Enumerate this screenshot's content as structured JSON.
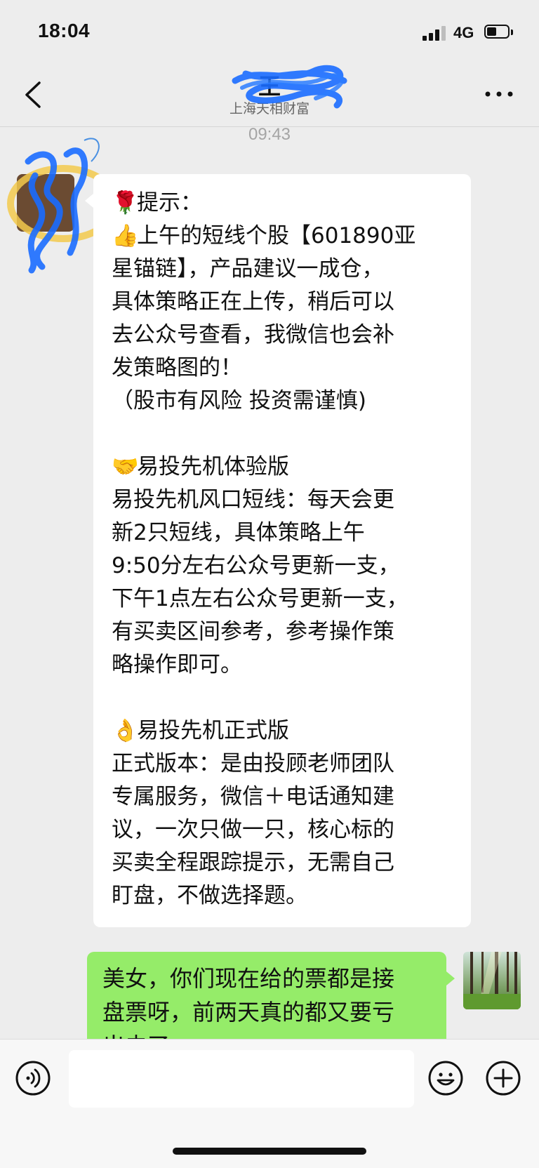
{
  "status": {
    "time": "18:04",
    "network": "4G",
    "battery_level": 0.45
  },
  "nav": {
    "title": "王",
    "subtitle": "上海天相财富",
    "back_icon": "chevron-left-icon",
    "more_icon": "ellipsis-icon"
  },
  "chat": {
    "timestamp": "09:43",
    "incoming_message": {
      "lines": [
        {
          "emoji": "🌹",
          "text": "提示："
        },
        {
          "emoji": "👍",
          "text": "上午的短线个股【601890亚\n星锚链】，产品建议一成仓，\n具体策略正在上传，稍后可以\n去公众号查看，我微信也会补\n发策略图的！\n（股市有风险 投资需谨慎)\n"
        },
        {
          "emoji": "🤝",
          "text": "易投先机体验版\n易投先机风口短线：每天会更\n新2只短线，具体策略上午\n9:50分左右公众号更新一支，\n下午1点左右公众号更新一支，\n有买卖区间参考，参考操作策\n略操作即可。\n"
        },
        {
          "emoji": "👌",
          "text": "易投先机正式版\n正式版本：是由投顾老师团队\n专属服务，微信＋电话通知建\n议，一次只做一只，核心标的\n买卖全程跟踪提示，无需自己\n盯盘，不做选择题。"
        }
      ]
    },
    "outgoing_message": {
      "text": "美女，你们现在给的票都是接\n盘票呀，前两天真的都又要亏\n出去了"
    }
  },
  "input_bar": {
    "voice_icon": "voice-icon",
    "emoji_icon": "smiley-icon",
    "plus_icon": "plus-icon",
    "input_value": ""
  },
  "colors": {
    "background": "#ededed",
    "incoming_bubble": "#ffffff",
    "outgoing_bubble": "#95ec69",
    "scribble": "#1a6cff"
  }
}
